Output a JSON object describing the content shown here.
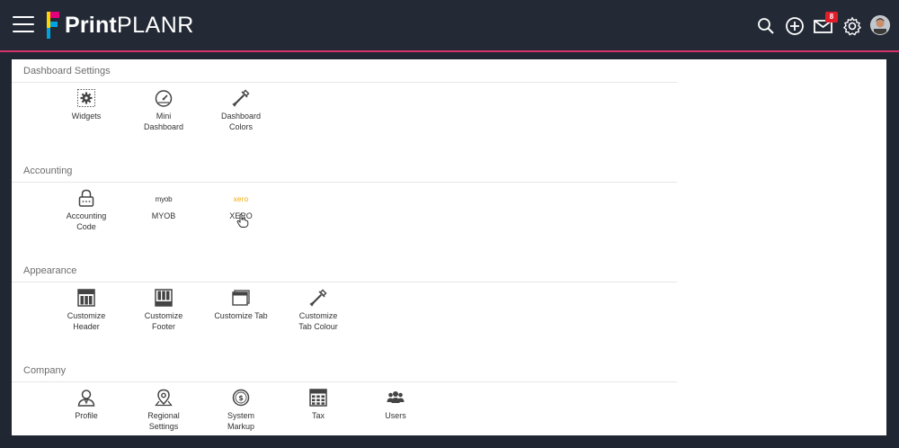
{
  "brand": {
    "name_bold": "Print",
    "name_light": "PLANR"
  },
  "header": {
    "notification_count": "8"
  },
  "colors": {
    "topbar": "#232a36",
    "accent": "#d6336c",
    "xero": "#f0a800",
    "badge": "#e11d2b"
  },
  "sections": [
    {
      "title": "Dashboard Settings",
      "items": [
        {
          "label_1": "Widgets",
          "label_2": "",
          "icon": "widgets-icon"
        },
        {
          "label_1": "Mini",
          "label_2": "Dashboard",
          "icon": "gauge-icon"
        },
        {
          "label_1": "Dashboard",
          "label_2": "Colors",
          "icon": "eyedropper-icon"
        }
      ]
    },
    {
      "title": "Accounting",
      "items": [
        {
          "label_1": "Accounting",
          "label_2": "Code",
          "icon": "lock-icon"
        },
        {
          "label_1": "MYOB",
          "label_2": "",
          "icon": "myob-logo",
          "logo_text": "myob"
        },
        {
          "label_1": "XERO",
          "label_2": "",
          "icon": "xero-logo",
          "logo_text": "xero"
        }
      ]
    },
    {
      "title": "Appearance",
      "items": [
        {
          "label_1": "Customize",
          "label_2": "Header",
          "icon": "header-layout-icon"
        },
        {
          "label_1": "Customize",
          "label_2": "Footer",
          "icon": "footer-layout-icon"
        },
        {
          "label_1": "Customize Tab",
          "label_2": "",
          "icon": "browser-tab-icon"
        },
        {
          "label_1": "Customize",
          "label_2": "Tab Colour",
          "icon": "eyedropper-icon"
        }
      ]
    },
    {
      "title": "Company",
      "items": [
        {
          "label_1": "Profile",
          "label_2": "",
          "icon": "user-profile-icon"
        },
        {
          "label_1": "Regional",
          "label_2": "Settings",
          "icon": "location-pin-icon"
        },
        {
          "label_1": "System",
          "label_2": "Markup",
          "icon": "dollar-coin-icon"
        },
        {
          "label_1": "Tax",
          "label_2": "",
          "icon": "tax-calculator-icon"
        },
        {
          "label_1": "Users",
          "label_2": "",
          "icon": "users-group-icon"
        }
      ]
    }
  ]
}
